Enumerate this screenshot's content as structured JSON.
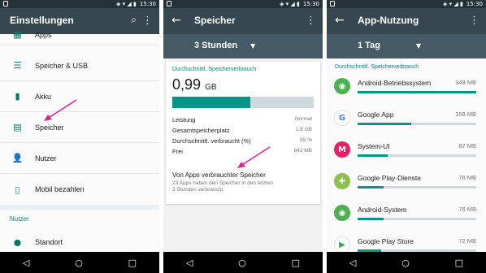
{
  "status": {
    "time": "15:30"
  },
  "screen1": {
    "title": "Einstellungen",
    "items": [
      {
        "label": "Apps",
        "icon": "apps-icon",
        "glyph": "▦"
      },
      {
        "label": "Speicher & USB",
        "icon": "storage-icon",
        "glyph": "☰"
      },
      {
        "label": "Akku",
        "icon": "battery-icon",
        "glyph": "▮"
      },
      {
        "label": "Speicher",
        "icon": "memory-icon",
        "glyph": "▤"
      },
      {
        "label": "Nutzer",
        "icon": "user-icon",
        "glyph": "👤"
      },
      {
        "label": "Mobil bezahlen",
        "icon": "nfc-pay-icon",
        "glyph": "▯"
      }
    ],
    "section": "Nutzer",
    "location": {
      "label": "Standort",
      "icon": "location-icon",
      "glyph": "⬤"
    }
  },
  "screen2": {
    "title": "Speicher",
    "dropdown": "3 Stunden",
    "section_title": "Durchschnittl. Speicherverbrauch",
    "big_value": "0,99",
    "big_unit": "GB",
    "usage_fraction": 0.55,
    "rows": [
      {
        "label": "Leistung",
        "value": "Normal"
      },
      {
        "label": "Gesamtspeicherplatz",
        "value": "1,8 GB"
      },
      {
        "label": "Durchschnittl. verbraucht (%)",
        "value": "55 %"
      },
      {
        "label": "Frei",
        "value": "842 MB"
      }
    ],
    "apps_title": "Von Apps verbrauchter Speicher",
    "apps_desc_line1": "23 Apps haben den Speicher in den letzten",
    "apps_desc_line2": "3 Stunden verbraucht."
  },
  "screen3": {
    "title": "App-Nutzung",
    "dropdown": "1 Tag",
    "section_title": "Durchschnittl. Speicherverbrauch",
    "apps": [
      {
        "name": "Android-Betriebssystem",
        "size": "348 MB",
        "fraction": 1.0,
        "color": "#4caf50",
        "glyph": "◉"
      },
      {
        "name": "Google App",
        "size": "158 MB",
        "fraction": 0.45,
        "color": "#ffffff",
        "glyph": "G"
      },
      {
        "name": "System-UI",
        "size": "87 MB",
        "fraction": 0.25,
        "color": "#e91e63",
        "glyph": "M"
      },
      {
        "name": "Google Play-Dienste",
        "size": "76 MB",
        "fraction": 0.22,
        "color": "#8bc34a",
        "glyph": "✚"
      },
      {
        "name": "Android-System",
        "size": "76 MB",
        "fraction": 0.22,
        "color": "#4caf50",
        "glyph": "◉"
      },
      {
        "name": "Google Play Store",
        "size": "72 MB",
        "fraction": 0.2,
        "color": "#ffffff",
        "glyph": "▶"
      }
    ]
  },
  "nav": {
    "back": "◁",
    "home": "○",
    "recents": "□"
  }
}
